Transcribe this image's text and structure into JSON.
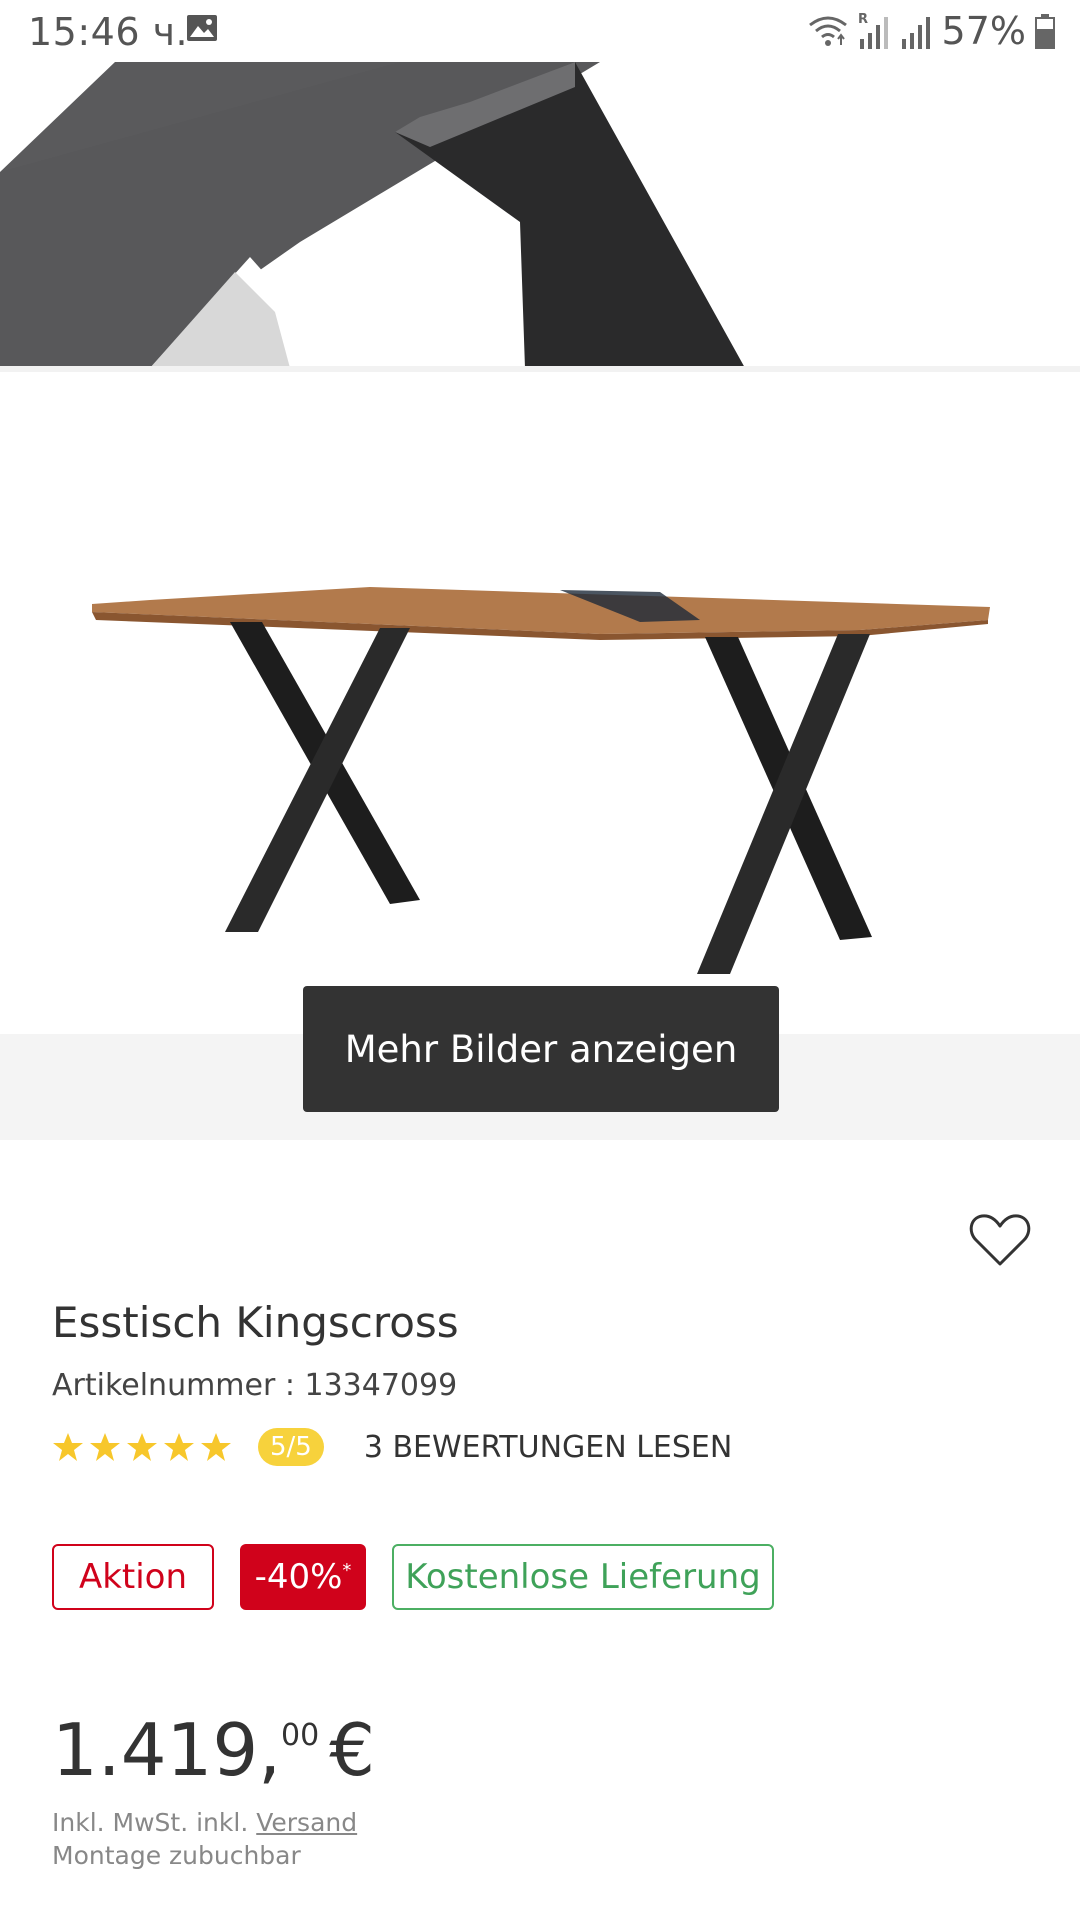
{
  "status_bar": {
    "time": "15:46 ч.",
    "battery_percent": "57%",
    "icons": [
      "gallery-icon",
      "wifi-icon",
      "signal-roaming-icon",
      "signal-icon",
      "battery-icon"
    ]
  },
  "gallery": {
    "more_images_label": "Mehr Bilder anzeigen"
  },
  "product": {
    "title": "Esstisch Kingscross",
    "article_number": "Artikelnummer : 13347099",
    "rating_stars": 5,
    "rating_label": "5/5",
    "reviews_link": "3 BEWERTUNGEN LESEN",
    "badges": {
      "promo": "Aktion",
      "discount": "-40%",
      "discount_mark": "*",
      "delivery": "Kostenlose Lieferung"
    },
    "price": {
      "main": "1.419,",
      "cents": "00",
      "currency": "€"
    },
    "price_note": {
      "prefix": "Inkl. MwSt. inkl. ",
      "shipping_link": "Versand",
      "assembly": "Montage zubuchbar"
    }
  },
  "colors": {
    "brand_red": "#d0021b",
    "delivery_green": "#4caf63",
    "rating_yellow": "#f7d23c",
    "button_dark": "#333333"
  }
}
